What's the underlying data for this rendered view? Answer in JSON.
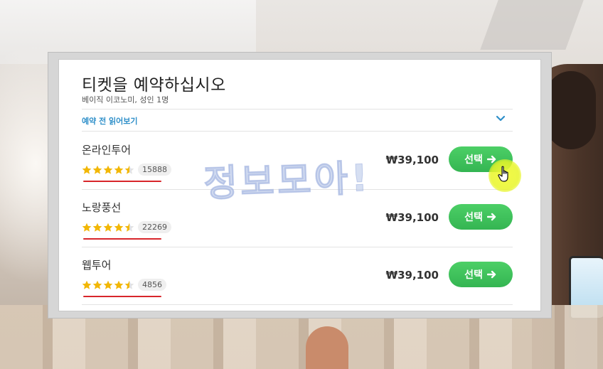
{
  "dialog": {
    "title": "티켓을 예약하십시오",
    "subtitle": "베이직 이코노미, 성인 1명",
    "info_label": "예약 전 읽어보기"
  },
  "offers": [
    {
      "vendor": "온라인투어",
      "rating": 4.5,
      "review_count": "15888",
      "price": "₩39,100",
      "button": "선택"
    },
    {
      "vendor": "노랑풍선",
      "rating": 4.5,
      "review_count": "22269",
      "price": "₩39,100",
      "button": "선택"
    },
    {
      "vendor": "웹투어",
      "rating": 4.5,
      "review_count": "4856",
      "price": "₩39,100",
      "button": "선택"
    }
  ],
  "watermark": "정보모아!",
  "colors": {
    "accent_blue": "#2e8fc9",
    "button_green": "#3cc25a",
    "star_gold": "#f2b705",
    "underline_red": "#d8262b"
  },
  "icons": {
    "chevron": "chevron-down-icon",
    "arrow": "arrow-right-icon",
    "star": "star-icon",
    "cursor": "hand-pointer-icon"
  }
}
